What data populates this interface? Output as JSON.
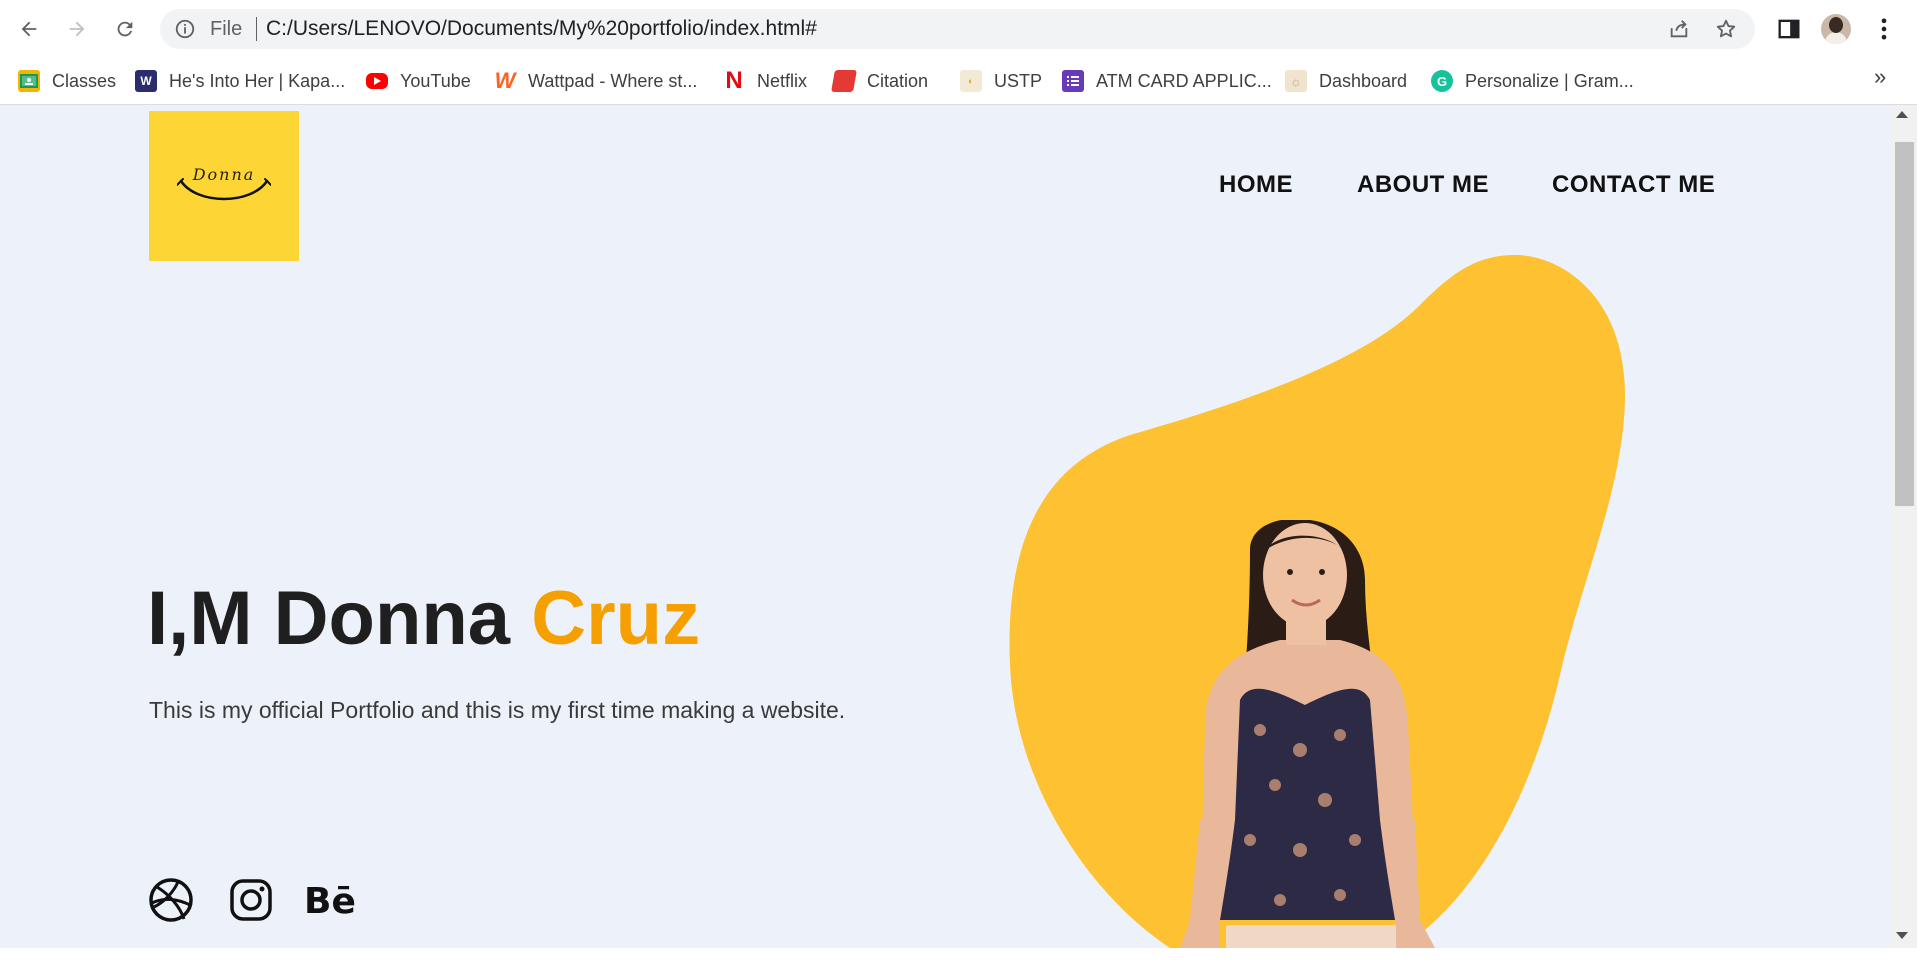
{
  "browser": {
    "scheme_label": "File",
    "url": "C:/Users/LENOVO/Documents/My%20portfolio/index.html#",
    "bookmarks": [
      {
        "label": "Classes",
        "icon": "google-classroom-icon",
        "color": "#f4b400"
      },
      {
        "label": "He's Into Her | Kapa...",
        "icon": "wattpad-webnovel-icon",
        "color": "#2b2d6e"
      },
      {
        "label": "YouTube",
        "icon": "youtube-icon",
        "color": "#ff0000"
      },
      {
        "label": "Wattpad - Where st...",
        "icon": "wattpad-icon",
        "color": "#ff6122"
      },
      {
        "label": "Netflix",
        "icon": "netflix-icon",
        "color": "#e50914"
      },
      {
        "label": "Citation",
        "icon": "book-icon",
        "color": "#e53935"
      },
      {
        "label": "USTP",
        "icon": "ustp-icon",
        "color": "#d9a441"
      },
      {
        "label": "ATM CARD APPLIC...",
        "icon": "google-forms-icon",
        "color": "#673ab7"
      },
      {
        "label": "Dashboard",
        "icon": "dashboard-icon",
        "color": "#c8a46e"
      },
      {
        "label": "Personalize | Gram...",
        "icon": "grammarly-icon",
        "color": "#15c39a"
      }
    ],
    "more_label": "»"
  },
  "site": {
    "logo_text": "Donna",
    "nav": [
      "HOME",
      "ABOUT ME",
      "CONTACT ME"
    ],
    "hero": {
      "title_prefix": "I,M Donna ",
      "title_accent": "Cruz",
      "description": "This is my official Portfolio and this is my first time making a website."
    },
    "social": [
      "dribbble-icon",
      "instagram-icon",
      "behance-icon"
    ],
    "behance_label": "Bē",
    "colors": {
      "accent": "#f5a000",
      "blob": "#fdc131",
      "logo_bg": "#fdd535",
      "page_bg": "#edf2fa"
    }
  }
}
